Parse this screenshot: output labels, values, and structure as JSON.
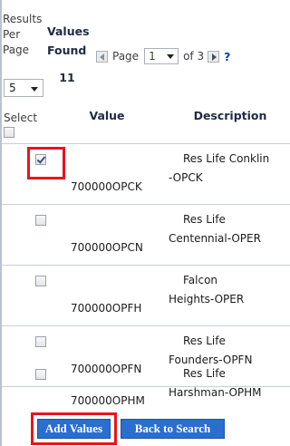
{
  "header": {
    "results_per_page_label": "Results Per Page",
    "results_per_page_value": "5",
    "values_found_label": "Values Found",
    "values_found_count": "11",
    "pager": {
      "prev_icon": "prev-page-arrow-icon",
      "page_label": "Page",
      "page_value": "1",
      "of_label": "of 3",
      "next_icon": "next-page-arrow-icon",
      "help_label": "?"
    }
  },
  "columns": {
    "select": "Select",
    "value": "Value",
    "description": "Description"
  },
  "rows": [
    {
      "checked": true,
      "value": "700000OPCK",
      "desc_line1": "Res Life Conklin",
      "desc_line2": "-OPCK"
    },
    {
      "checked": false,
      "value": "700000OPCN",
      "desc_line1": "Res Life",
      "desc_line2": "Centennial-OPER"
    },
    {
      "checked": false,
      "value": "700000OPFH",
      "desc_line1": "Falcon",
      "desc_line2": "Heights-OPER"
    },
    {
      "checked": false,
      "value": "700000OPFN",
      "desc_line1": "Res Life",
      "desc_line2": "Founders-OPFN"
    },
    {
      "checked": false,
      "value": "700000OPHM",
      "desc_line1": "Res Life",
      "desc_line2": "Harshman-OPHM"
    }
  ],
  "footer": {
    "add_values_label": "Add Values",
    "back_to_search_label": "Back to Search"
  },
  "colors": {
    "highlight": "#e8141c",
    "button_blue": "#2a6ed0",
    "header_text": "#1e2b44"
  }
}
